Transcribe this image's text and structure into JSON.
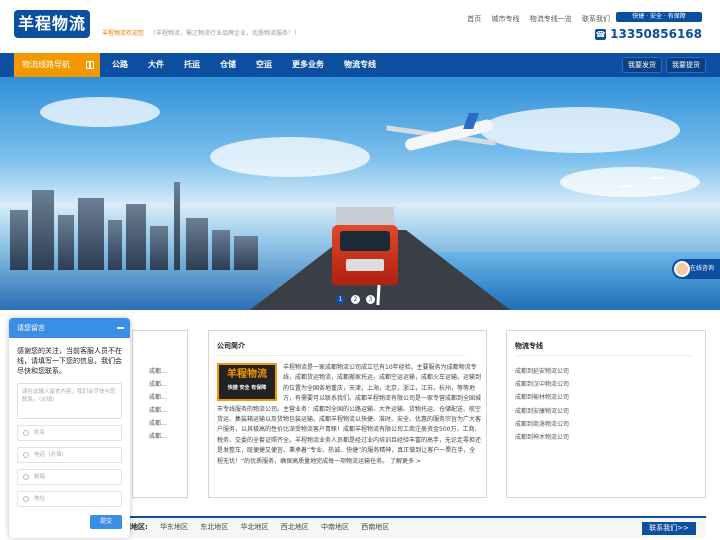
{
  "header": {
    "logo_text": "羊程物流",
    "welcome": "羊程物流欢迎您",
    "welcome_sub": "（羊程物流，蜀辽物流行业品牌企业，优质物流服务！）",
    "links": [
      "首页",
      "城市专线",
      "物流专线一览",
      "联系我们"
    ],
    "slogan": "快捷 · 安全 · 有保障",
    "phone": "13350856168"
  },
  "nav": {
    "first": "物流线路导航",
    "items": [
      "公路",
      "大件",
      "托运",
      "仓储",
      "空运",
      "更多业务",
      "物流专线"
    ],
    "btn_ship": "我要发货",
    "btn_pickup": "我要提货"
  },
  "hero": {
    "dots": [
      "1",
      "2",
      "3"
    ],
    "active_dot": 1,
    "online_label": "在线咨询"
  },
  "left_box": {
    "items": [
      "成都...",
      "成都...",
      "成都...",
      "成都...",
      "成都...",
      "成都..."
    ]
  },
  "about": {
    "title": "公司简介",
    "logo_text": "羊程物流",
    "logo_sub": "快捷 安全 有保障",
    "text": "羊程物流是一家成都物流公司成立已有10年经验。主要服务为成都物流专线，成都货运物流，成都搬家托运，成都空运运输，成都火车运输。运输到的位置为全国各地重庆，天津，上海，北京，浙江，江苏，杭州，等等地方，有需要可以联系我们。成都羊程物流有限公司是一家专营成都到全国城市专线服务的物流公司。主营业务：成都到全国的公路运输、大件运输、货物托运、仓储配送、航空货运、集装箱运输以及货物包装运输。成都羊程物流以快捷、准时、安全、优惠的服务宗旨为广大客户服务，以其极高的性价比深受物流客户青睐！成都羊程物流有限公司工商注册资金500万，工商、税务、交委的全套证照齐全。羊程物流业务人员都是经过业内培训且经验丰富的高手，无论走零担还是发整车，既便捷又便宜。秉承着“专业、热诚、快捷”的服务精神，真正做到让客户一票在手，全程无忧！“的优质服务，确保高质量地完成每一项物流运输任务。",
    "more": "了解更多 >"
  },
  "routes": {
    "title": "物流专线",
    "items": [
      "成都到延安物流公司",
      "成都到汉中物流公司",
      "成都到榆林物流公司",
      "成都到安康物流公司",
      "成都到商洛物流公司",
      "成都到神木物流公司"
    ]
  },
  "region": {
    "label": "门地区:",
    "items": [
      "华东地区",
      "东北地区",
      "华北地区",
      "西北地区",
      "中南地区",
      "西南地区"
    ],
    "contact": "联系我们>>"
  },
  "chat": {
    "title": "请您留言",
    "message": "感谢您的关注，当前客服人员不在线，请填写一下您的信息，我们会尽快和您联系。",
    "textarea_placeholder": "请在此输入留言内容，我们会尽快与您联系。（必填）",
    "fields": [
      "姓名",
      "电话（必填）",
      "邮箱",
      "地址"
    ],
    "submit": "提交"
  }
}
